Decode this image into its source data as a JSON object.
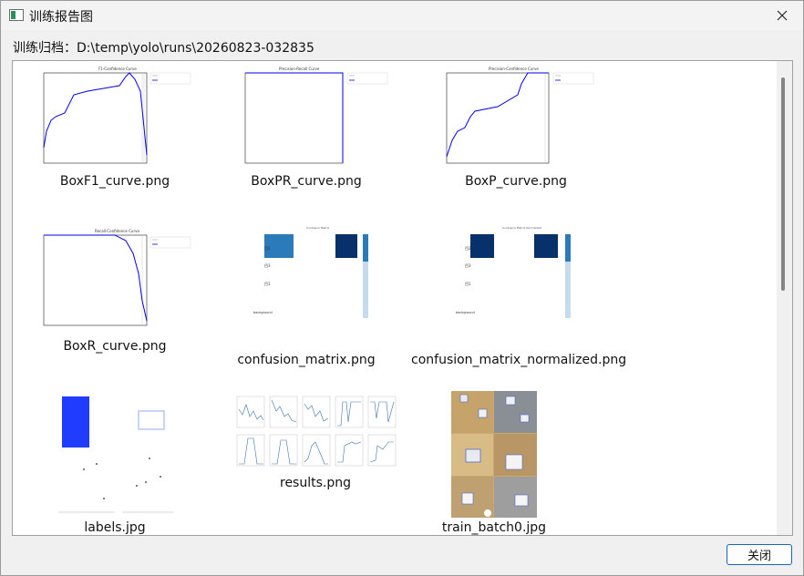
{
  "window": {
    "title": "训练报告图",
    "close_icon": "close-icon",
    "app_icon": "chart-window-icon"
  },
  "path_label": "训练归档：D:\\temp\\yolo\\runs\\20260823-032835",
  "gallery": {
    "items": [
      {
        "caption": "BoxF1_curve.png"
      },
      {
        "caption": "BoxPR_curve.png"
      },
      {
        "caption": "BoxP_curve.png"
      },
      {
        "caption": "BoxR_curve.png"
      },
      {
        "caption": "confusion_matrix.png"
      },
      {
        "caption": "confusion_matrix_normalized.png"
      },
      {
        "caption": "labels.jpg"
      },
      {
        "caption": "results.png"
      },
      {
        "caption": "train_batch0.jpg"
      }
    ]
  },
  "buttons": {
    "close": "关闭"
  },
  "colors": {
    "curve": "#0000ee",
    "heat_dark": "#08306b",
    "heat_mid": "#2b7bba",
    "accent": "#1565c0"
  }
}
